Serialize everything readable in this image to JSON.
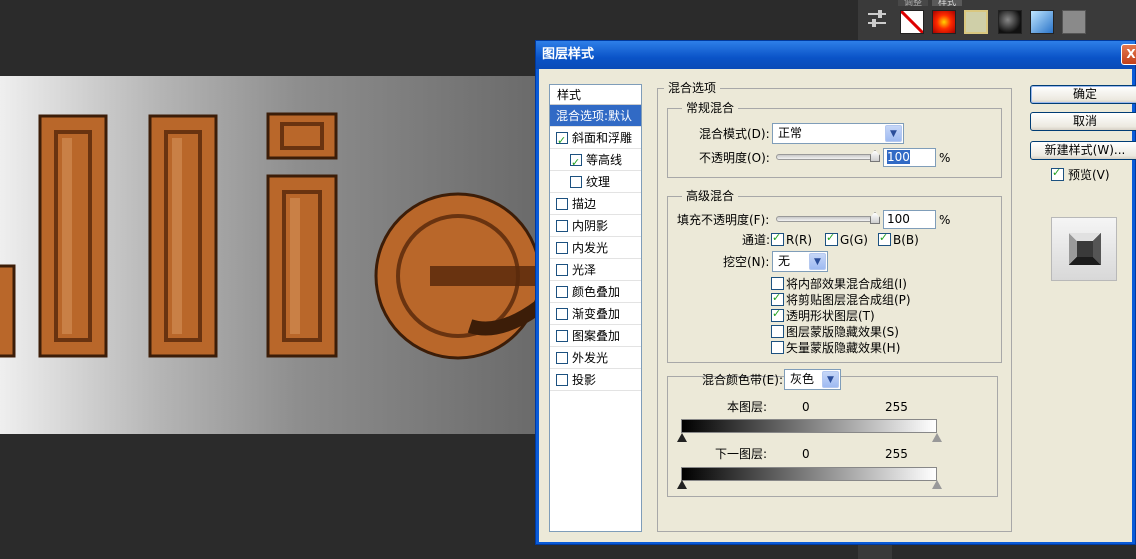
{
  "canvas": {
    "letters": "llie"
  },
  "styles_panel": {
    "tabs": [
      "调整",
      "样式"
    ],
    "swatches": [
      "no-style-swatch",
      "red-glow-swatch",
      "frame-swatch",
      "dark-orb-swatch",
      "blue-glass-swatch",
      "gray-swatch"
    ]
  },
  "dialog": {
    "title": "图层样式",
    "close_label": "X",
    "style_list": {
      "header": "样式",
      "items": [
        {
          "label": "混合选项:默认",
          "selected": true
        },
        {
          "label": "斜面和浮雕",
          "checked": true
        },
        {
          "label": "等高线",
          "checked": true,
          "sub": true
        },
        {
          "label": "纹理",
          "checked": false,
          "sub": true
        },
        {
          "label": "描边",
          "checked": false
        },
        {
          "label": "内阴影",
          "checked": false
        },
        {
          "label": "内发光",
          "checked": false
        },
        {
          "label": "光泽",
          "checked": false
        },
        {
          "label": "颜色叠加",
          "checked": false
        },
        {
          "label": "渐变叠加",
          "checked": false
        },
        {
          "label": "图案叠加",
          "checked": false
        },
        {
          "label": "外发光",
          "checked": false
        },
        {
          "label": "投影",
          "checked": false
        }
      ]
    },
    "blend_options": {
      "title": "混合选项",
      "general": {
        "title": "常规混合",
        "mode_label": "混合模式(D):",
        "mode_value": "正常",
        "opacity_label": "不透明度(O):",
        "opacity_value": "100",
        "opacity_unit": "%",
        "opacity_level": 1.0
      },
      "advanced": {
        "title": "高级混合",
        "fill_label": "填充不透明度(F):",
        "fill_value": "100",
        "fill_unit": "%",
        "fill_level": 1.0,
        "channels_label": "通道:",
        "channel_r": "R(R)",
        "channel_g": "G(G)",
        "channel_b": "B(B)",
        "knockout_label": "挖空(N):",
        "knockout_value": "无",
        "opts": [
          {
            "label": "将内部效果混合成组(I)",
            "checked": false
          },
          {
            "label": "将剪贴图层混合成组(P)",
            "checked": true
          },
          {
            "label": "透明形状图层(T)",
            "checked": true
          },
          {
            "label": "图层蒙版隐藏效果(S)",
            "checked": false
          },
          {
            "label": "矢量蒙版隐藏效果(H)",
            "checked": false
          }
        ]
      },
      "blend_if": {
        "label": "混合颜色带(E):",
        "value": "灰色",
        "this_layer": "本图层:",
        "underlying": "下一图层:",
        "min": "0",
        "max": "255"
      }
    },
    "buttons": {
      "ok": "确定",
      "cancel": "取消",
      "new_style": "新建样式(W)...",
      "preview": "预览(V)"
    }
  }
}
